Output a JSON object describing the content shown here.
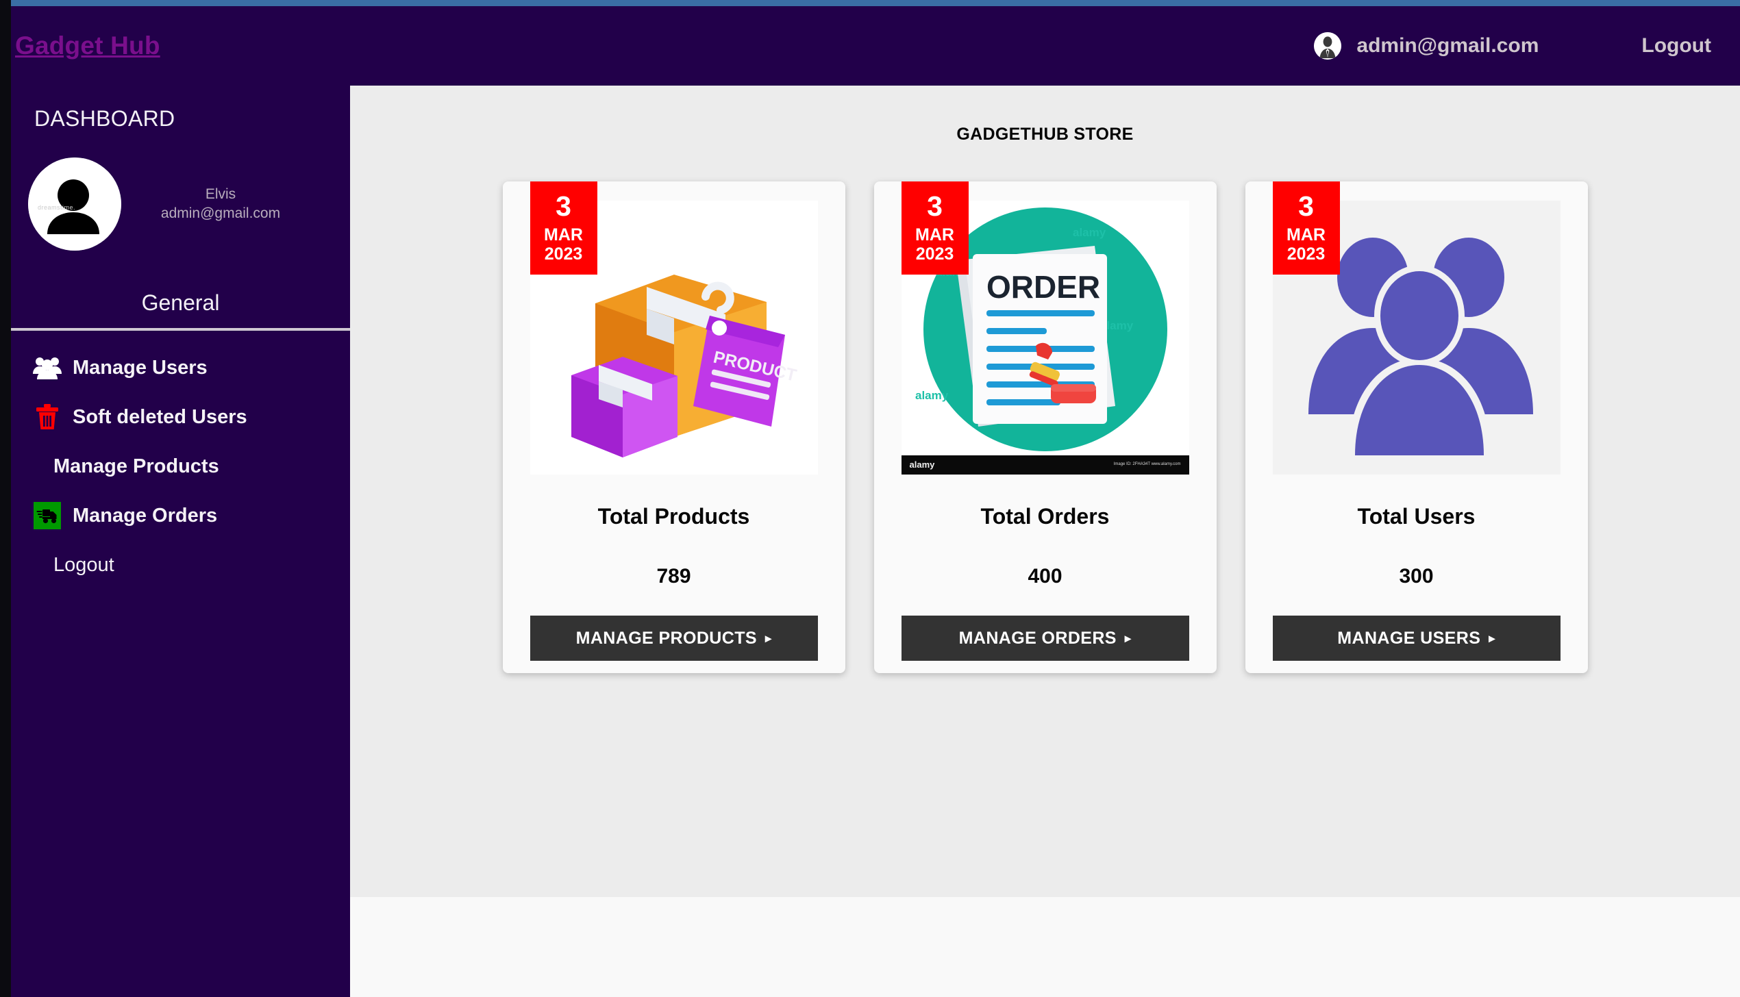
{
  "header": {
    "brand": "Gadget Hub",
    "account_email": "admin@gmail.com",
    "logout_label": "Logout",
    "avatar_icon": "user-avatar-icon",
    "background_color": "#22004a",
    "brand_color": "#7a0f8c"
  },
  "sidebar": {
    "title": "DASHBOARD",
    "profile": {
      "name": "Elvis",
      "email": "admin@gmail.com",
      "avatar_icon": "person-silhouette-icon",
      "watermark": "dreamstime."
    },
    "section_label": "General",
    "items": [
      {
        "label": "Manage Users",
        "icon": "users-group-icon",
        "icon_color": "#ffffff"
      },
      {
        "label": "Soft deleted Users",
        "icon": "trash-icon",
        "icon_color": "#ff0000"
      },
      {
        "label": "Manage Products",
        "icon": "none",
        "icon_color": ""
      },
      {
        "label": "Manage Orders",
        "icon": "delivery-truck-icon",
        "icon_color": "#009a00"
      }
    ],
    "logout_label": "Logout",
    "background_color": "#22004a"
  },
  "main": {
    "title": "GADGETHUB STORE",
    "background_color": "#ececec",
    "cards": [
      {
        "date": {
          "day": "3",
          "month": "MAR",
          "year": "2023"
        },
        "image": "product-boxes-tag-image",
        "title": "Total Products",
        "value": "789",
        "button_label": "MANAGE PRODUCTS",
        "button_caret": "▸"
      },
      {
        "date": {
          "day": "3",
          "month": "MAR",
          "year": "2023"
        },
        "image": "order-document-stamp-image",
        "title": "Total Orders",
        "value": "400",
        "button_label": "MANAGE ORDERS",
        "button_caret": "▸",
        "watermark": "alamy",
        "watermark_sub": "Image ID: 2FHA34T\nwww.alamy.com"
      },
      {
        "date": {
          "day": "3",
          "month": "MAR",
          "year": "2023"
        },
        "image": "users-group-image",
        "title": "Total Users",
        "value": "300",
        "button_label": "MANAGE USERS",
        "button_caret": "▸"
      }
    ]
  },
  "colors": {
    "badge_red": "#ff0000",
    "button_dark": "#333333",
    "top_strip_blue": "#3a6ea5"
  }
}
